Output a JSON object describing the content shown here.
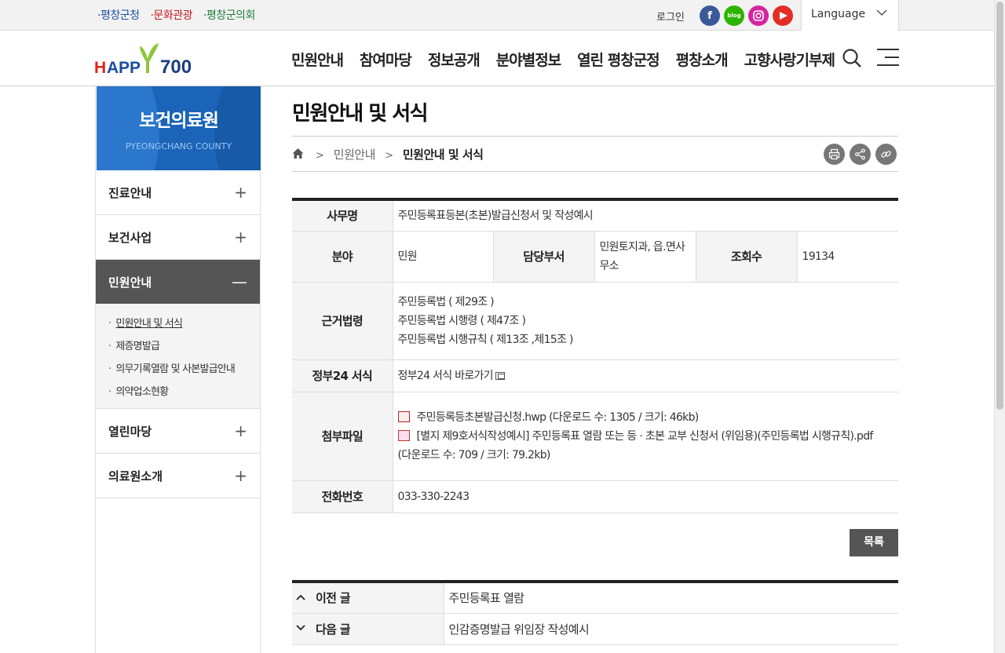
{
  "topbar": {
    "sites": [
      {
        "label": "·평창군청",
        "color": "#1a4e9c"
      },
      {
        "label": "·문화관광",
        "color": "#c8191f"
      },
      {
        "label": "·평창군의회",
        "color": "#1e7a3c"
      }
    ],
    "login": "로그인",
    "language": "Language"
  },
  "header": {
    "logo_text": "HAPPY700",
    "nav": [
      "민원안내",
      "참여마당",
      "정보공개",
      "분야별정보",
      "열린 평창군정",
      "평창소개",
      "고향사랑기부제"
    ]
  },
  "sidebar": {
    "title": "보건의료원",
    "subtitle": "PYEONGCHANG COUNTY",
    "items": [
      {
        "label": "진료안내",
        "toggle": "+"
      },
      {
        "label": "보건사업",
        "toggle": "+"
      },
      {
        "label": "민원안내",
        "toggle": "—"
      },
      {
        "label": "열린마당",
        "toggle": "+"
      },
      {
        "label": "의료원소개",
        "toggle": "+"
      }
    ],
    "sub_items": [
      "민원안내 및 서식",
      "제증명발급",
      "의무기록열람 및 사본발급안내",
      "의약업소현황"
    ]
  },
  "page": {
    "title": "민원안내 및 서식",
    "breadcrumb": [
      "민원안내",
      "민원안내 및 서식"
    ],
    "breadcrumb_sep": ">"
  },
  "detail": {
    "work_name_label": "사무명",
    "work_name": "주민등록표등본(초본)발급신청서 및 작성예시",
    "field_label": "분야",
    "field": "민원",
    "dept_label": "담당부서",
    "dept": "민원토지과, 읍.면사무소",
    "views_label": "조회수",
    "views": "19134",
    "law_label": "근거법령",
    "laws": [
      "주민등록법 ( 제29조 )",
      "주민등록법 시행령 ( 제47조 )",
      "주민등록법 시행규칙 ( 제13조 ,제15조 )"
    ],
    "gov24_label": "정부24 서식",
    "gov24_link": "정부24 서식 바로가기",
    "attach_label": "첨부파일",
    "attachments": [
      {
        "name": "주민등록등초본발급신청.hwp",
        "info": "(다운로드 수: 1305 / 크기: 46kb)"
      },
      {
        "name": "[별지 제9호서식작성예시] 주민등록표 열람 또는 등 · 초본 교부 신청서 (위임용)(주민등록법 시행규칙).pdf",
        "info": "(다운로드 수: 709 / 크기: 79.2kb)"
      }
    ],
    "phone_label": "전화번호",
    "phone": "033-330-2243"
  },
  "list_button": "목록",
  "prev_next": {
    "prev_label": "이전 글",
    "prev_title": "주민등록표 열람",
    "next_label": "다음 글",
    "next_title": "인감증명발급 위임장 작성예시"
  }
}
